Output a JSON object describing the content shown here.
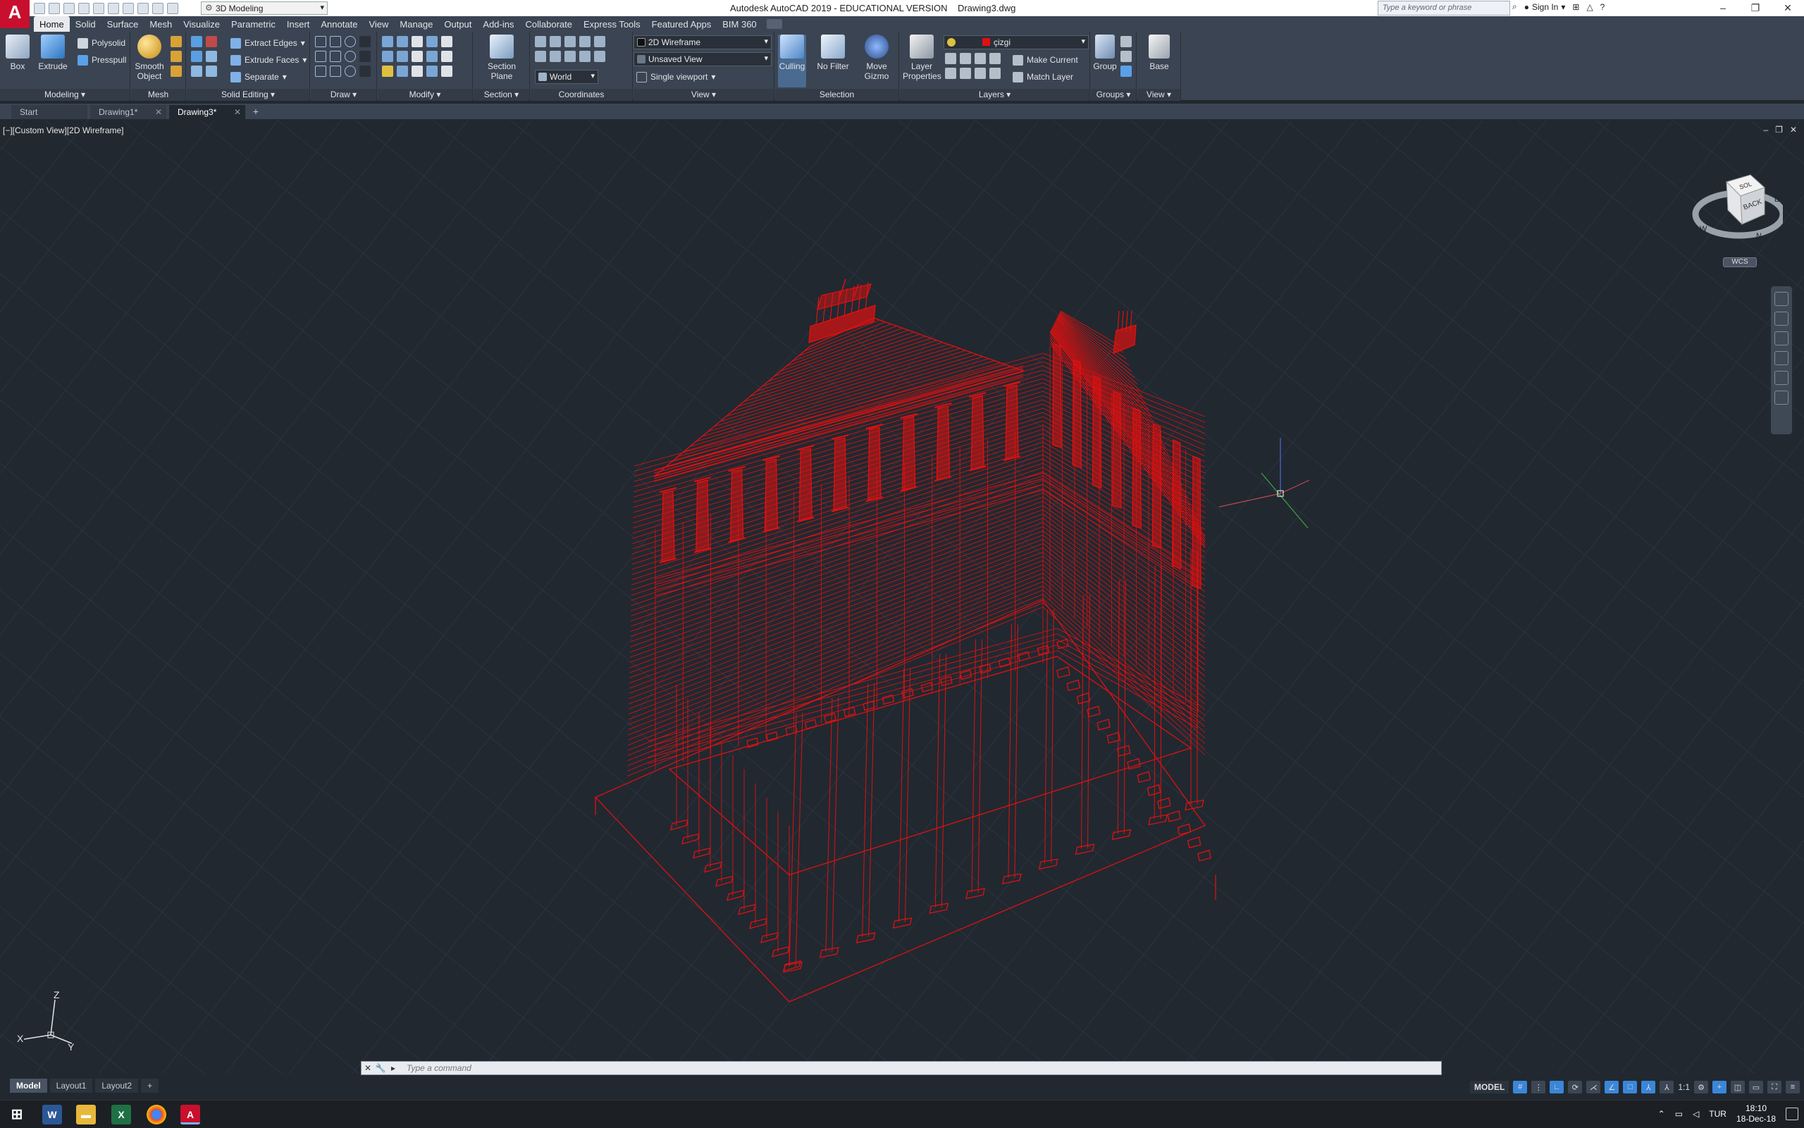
{
  "title_bar": {
    "title": "Autodesk AutoCAD 2019 - EDUCATIONAL VERSION    Drawing3.dwg",
    "workspace": "3D Modeling",
    "search_placeholder": "Type a keyword or phrase",
    "sign_in": "Sign In",
    "app_logo": "A"
  },
  "ribbon_tabs": [
    "Home",
    "Solid",
    "Surface",
    "Mesh",
    "Visualize",
    "Parametric",
    "Insert",
    "Annotate",
    "View",
    "Manage",
    "Output",
    "Add-ins",
    "Collaborate",
    "Express Tools",
    "Featured Apps",
    "BIM 360"
  ],
  "ribbon": {
    "modeling": {
      "title": "Modeling ▾",
      "box": "Box",
      "extrude": "Extrude",
      "polysolid": "Polysolid",
      "presspull": "Presspull"
    },
    "mesh": {
      "title": "Mesh",
      "smooth_object": "Smooth Object"
    },
    "solid_editing": {
      "title": "Solid Editing ▾",
      "extract_edges": "Extract Edges",
      "extrude_faces": "Extrude Faces",
      "separate": "Separate"
    },
    "draw": {
      "title": "Draw ▾"
    },
    "modify": {
      "title": "Modify ▾"
    },
    "section": {
      "title": "Section ▾",
      "section_plane": "Section Plane"
    },
    "coordinates": {
      "title": "Coordinates",
      "world": "World"
    },
    "view": {
      "title": "View ▾",
      "visual_style": "2D Wireframe",
      "named_view": "Unsaved View",
      "viewport": "Single viewport"
    },
    "selection": {
      "title": "Selection",
      "culling": "Culling",
      "no_filter": "No Filter",
      "move_gizmo": "Move Gizmo"
    },
    "layers": {
      "title": "Layers ▾",
      "layer_properties": "Layer Properties",
      "current_layer": "çizgi",
      "make_current": "Make Current",
      "match_layer": "Match Layer"
    },
    "groups": {
      "title": "Groups ▾",
      "group": "Group"
    },
    "view2": {
      "title": "View ▾",
      "base": "Base"
    }
  },
  "file_tabs": [
    {
      "label": "Start"
    },
    {
      "label": "Drawing1*"
    },
    {
      "label": "Drawing3*"
    }
  ],
  "viewport": {
    "label": "[−][Custom View][2D Wireframe]",
    "viewcube_face": "BACK",
    "viewcube_top": "SOL",
    "compass": {
      "w": "W",
      "n": "N",
      "e": "E"
    },
    "wcs": "WCS",
    "ucs": {
      "x": "X",
      "y": "Y",
      "z": "Z"
    }
  },
  "command_line": {
    "placeholder": "Type a command"
  },
  "layout_tabs": [
    "Model",
    "Layout1",
    "Layout2"
  ],
  "status_bar": {
    "model": "MODEL",
    "scale": "1:1"
  },
  "taskbar": {
    "language": "TUR",
    "time": "18:10",
    "date": "18-Dec-18"
  },
  "colors": {
    "model_lines": "#e01010",
    "background": "#212830",
    "ribbon": "#3b4452",
    "accent": "#3b86d9"
  }
}
